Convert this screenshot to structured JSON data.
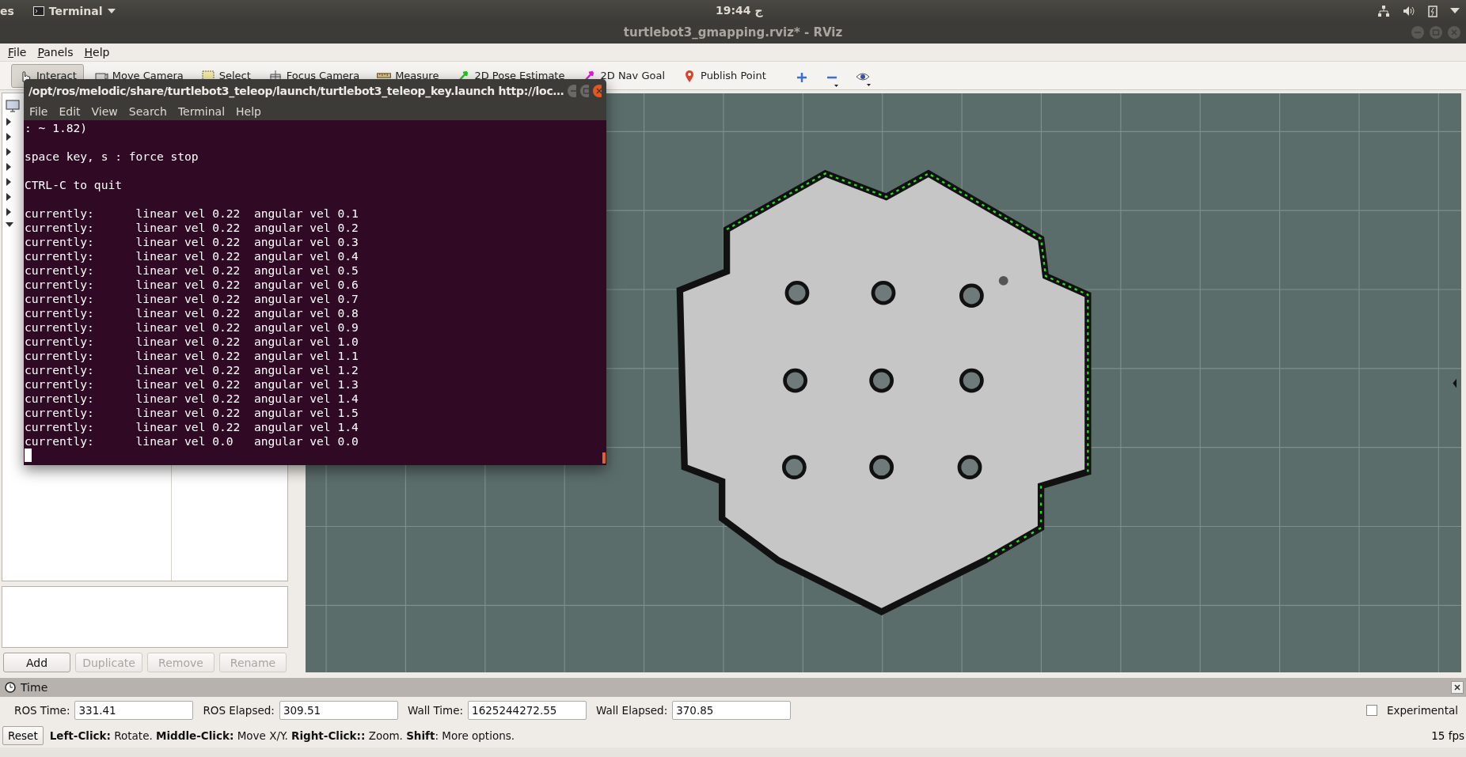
{
  "top_panel": {
    "left_label": "es",
    "app_menu": "Terminal",
    "clock": "19:44 ج"
  },
  "window": {
    "title": "turtlebot3_gmapping.rviz* - RViz"
  },
  "menu": [
    {
      "label": "File"
    },
    {
      "label": "Panels"
    },
    {
      "label": "Help"
    }
  ],
  "toolbar": [
    {
      "kind": "interact",
      "label": "Interact",
      "selected": true
    },
    {
      "kind": "move_camera",
      "label": "Move Camera",
      "selected": false
    },
    {
      "kind": "select",
      "label": "Select",
      "selected": false
    },
    {
      "kind": "focus_camera",
      "label": "Focus Camera",
      "selected": false
    },
    {
      "kind": "measure",
      "label": "Measure",
      "selected": false
    },
    {
      "kind": "pose_estimate",
      "label": "2D Pose Estimate",
      "selected": false
    },
    {
      "kind": "nav_goal",
      "label": "2D Nav Goal",
      "selected": false
    },
    {
      "kind": "publish_point",
      "label": "Publish Point",
      "selected": false
    }
  ],
  "view_tools": [
    {
      "kind": "plus"
    },
    {
      "kind": "minus"
    },
    {
      "kind": "eye"
    }
  ],
  "left_panel": {
    "buttons": [
      {
        "label": "Add",
        "disabled": false
      },
      {
        "label": "Duplicate",
        "disabled": true
      },
      {
        "label": "Remove",
        "disabled": true
      },
      {
        "label": "Rename",
        "disabled": true
      }
    ]
  },
  "terminal": {
    "title": "/opt/ros/melodic/share/turtlebot3_teleop/launch/turtlebot3_teleop_key.launch http://loc…",
    "menu": [
      "File",
      "Edit",
      "View",
      "Search",
      "Terminal",
      "Help"
    ],
    "blocks": [
      [
        ": ~ 1.82)"
      ],
      [
        "space key, s : force stop"
      ],
      [
        "CTRL-C to quit"
      ],
      [
        "currently:      linear vel 0.22  angular vel 0.1",
        "currently:      linear vel 0.22  angular vel 0.2",
        "currently:      linear vel 0.22  angular vel 0.3",
        "currently:      linear vel 0.22  angular vel 0.4",
        "currently:      linear vel 0.22  angular vel 0.5",
        "currently:      linear vel 0.22  angular vel 0.6",
        "currently:      linear vel 0.22  angular vel 0.7",
        "currently:      linear vel 0.22  angular vel 0.8",
        "currently:      linear vel 0.22  angular vel 0.9",
        "currently:      linear vel 0.22  angular vel 1.0",
        "currently:      linear vel 0.22  angular vel 1.1",
        "currently:      linear vel 0.22  angular vel 1.2",
        "currently:      linear vel 0.22  angular vel 1.3",
        "currently:      linear vel 0.22  angular vel 1.4",
        "currently:      linear vel 0.22  angular vel 1.5",
        "currently:      linear vel 0.22  angular vel 1.4",
        "currently:      linear vel 0.0   angular vel 0.0"
      ]
    ]
  },
  "time_panel": {
    "title": "Time",
    "fields": [
      {
        "label": "ROS Time:",
        "value": "331.41"
      },
      {
        "label": "ROS Elapsed:",
        "value": "309.51"
      },
      {
        "label": "Wall Time:",
        "value": "1625244272.55"
      },
      {
        "label": "Wall Elapsed:",
        "value": "370.85"
      }
    ],
    "experimental": {
      "label": "Experimental",
      "checked": false
    }
  },
  "status_bar": {
    "reset": "Reset",
    "hint": "**Left-Click:** Rotate. **Middle-Click:** Move X/Y. **Right-Click::** Zoom. **Shift**: More options.",
    "fps": "15 fps"
  }
}
